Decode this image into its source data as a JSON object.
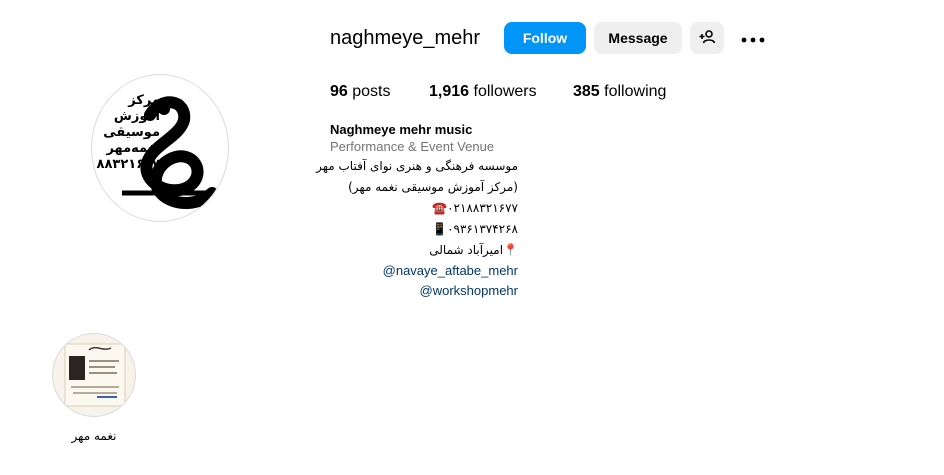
{
  "profile": {
    "username": "naghmeye_mehr",
    "avatar": {
      "logo_lines": [
        "مرکز",
        "آموزش",
        "موسیقی",
        "نغمه‌مهر",
        "۸۸۳۲۱۶۷۷"
      ]
    }
  },
  "actions": {
    "follow_label": "Follow",
    "message_label": "Message",
    "add_user_icon": "person-add-icon",
    "more_icon": "more-options-icon"
  },
  "stats": {
    "posts_count": "96",
    "posts_label": "posts",
    "followers_count": "1,916",
    "followers_label": "followers",
    "following_count": "385",
    "following_label": "following"
  },
  "bio": {
    "name": "Naghmeye mehr music",
    "category": "Performance & Event Venue",
    "lines": [
      "موسسه فرهنگی و هنری نوای آفتاب مهر",
      "(مرکز آموزش موسیقی نغمه مهر)",
      "۰۲۱۸۸۳۲۱۶۷۷☎️",
      "۰۹۳۶۱۳۷۴۲۶۸📱",
      "📍امیرآباد شمالی"
    ],
    "links": [
      "navaye_aftabe_mehr@",
      "workshopmehr@"
    ]
  },
  "highlights": [
    {
      "label": "نغمه مهر"
    }
  ],
  "colors": {
    "follow_bg": "#0095f6",
    "secondary_bg": "#efefef",
    "category_text": "#737373",
    "link_text": "#00376b"
  }
}
